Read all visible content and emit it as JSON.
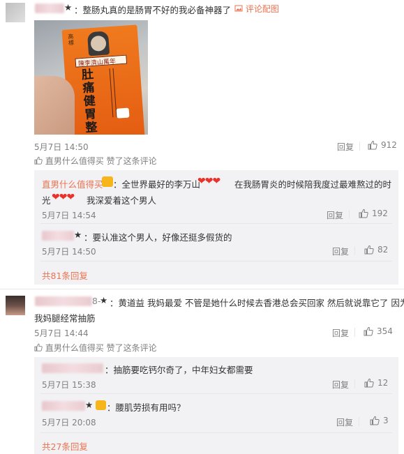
{
  "comment1": {
    "star": "★",
    "text": "：整肠丸真的是肠胃不好的我必备神器了",
    "image_action": "评论配图",
    "time": "5月7日 14:50",
    "reply_label": "回复",
    "likes": "912",
    "liked_by": "直男什么值得买",
    "liked_suffix": "赞了这条评论",
    "product": {
      "brand_top": "高標",
      "banner": "陳李濟山萬年",
      "name": "肚痛健胃整腸丸"
    }
  },
  "reply1": {
    "author": "直男什么值得买",
    "text_a": "：全世界最好的李万山",
    "text_b": "在我肠胃炎的时候陪我度过最难熬过的时",
    "text_c": "光",
    "text_d": "我深爱着这个男人",
    "hearts": "❤❤❤",
    "time": "5月7日 14:54",
    "reply_label": "回复",
    "likes": "192"
  },
  "reply2": {
    "star": "★",
    "text": "：要认准这个男人，好像还挺多假货的",
    "time": "5月7日 14:50",
    "reply_label": "回复",
    "likes": "82"
  },
  "more1": "共81条回复",
  "comment2": {
    "suffix": "8-",
    "star": "★",
    "text_a": "：黄道益 我妈最爱 不管是她什么时候去香港总会买回家 然后就说靠它了 因为",
    "text_b": "我妈腿经常抽筋",
    "time": "5月7日 14:44",
    "reply_label": "回复",
    "likes": "354",
    "liked_by": "直男什么值得买",
    "liked_suffix": "赞了这条评论"
  },
  "reply3": {
    "text": "：抽筋要吃钙尔奇了，中年妇女都需要",
    "time": "5月7日 15:38",
    "reply_label": "回复",
    "likes": "12"
  },
  "reply4": {
    "star": "★",
    "text": "：腰肌劳损有用吗？",
    "time": "5月7日 20:08",
    "reply_label": "回复",
    "likes": "3"
  },
  "more2": "共27条回复",
  "colors": {
    "accent": "#eb7350",
    "star": "#e8432a",
    "reply_bg": "#f2f2f5",
    "heart": "#e8322a"
  }
}
